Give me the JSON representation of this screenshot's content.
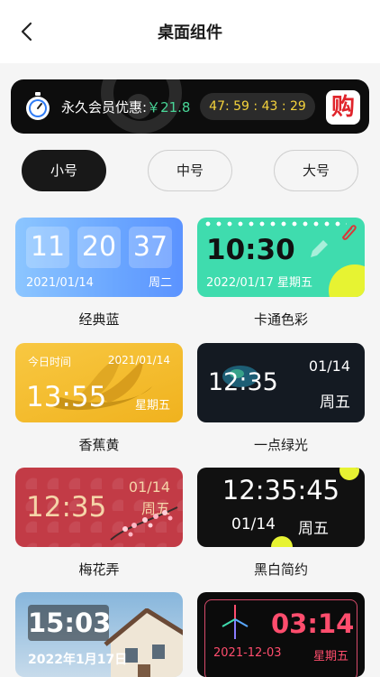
{
  "header": {
    "title": "桌面组件",
    "back_icon": "chevron-left-icon"
  },
  "promo": {
    "text": "永久会员优惠:",
    "price": "￥21.8",
    "countdown": "47: 59 : 43 : 29",
    "buy_label": "购",
    "accent_color": "#48d597",
    "countdown_color": "#f5d33c",
    "buy_color": "#e0242b"
  },
  "size_tabs": {
    "small": "小号",
    "medium": "中号",
    "large": "大号",
    "selected": "小号"
  },
  "widgets": {
    "classic_blue": {
      "hour": "11",
      "minute": "20",
      "second": "37",
      "date": "2021/01/14",
      "weekday": "周二",
      "name": "经典蓝"
    },
    "cartoon": {
      "time": "10:30",
      "date": "2022/01/17  星期五",
      "name": "卡通色彩"
    },
    "banana": {
      "label": "今日时间",
      "date": "2021/01/14",
      "time": "13:55",
      "weekday": "星期五",
      "name": "香蕉黄"
    },
    "green_dot": {
      "time": "12:35",
      "date": "01/14",
      "weekday": "周五",
      "name": "一点绿光"
    },
    "plum": {
      "time": "12:35",
      "date": "01/14",
      "weekday": "周五",
      "name": "梅花弄"
    },
    "black_white": {
      "time": "12:35:45",
      "date": "01/14",
      "weekday": "周五",
      "name": "黑白简约"
    },
    "house": {
      "time": "15:03",
      "date": "2022年1月17日"
    },
    "neon": {
      "time": "03:14",
      "date": "2021-12-03",
      "weekday": "星期五"
    }
  }
}
